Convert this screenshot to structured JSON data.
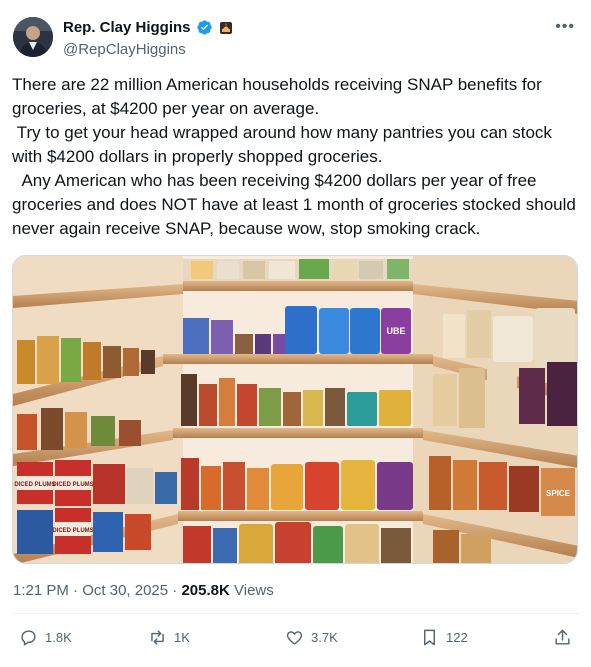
{
  "author": {
    "display_name": "Rep. Clay Higgins",
    "handle": "@RepClayHiggins",
    "verified_icon": "verified-badge-icon",
    "affiliation_icon": "us-capitol-icon",
    "avatar_icon": "profile-photo"
  },
  "tweet": {
    "text": "There are 22 million American households receiving SNAP benefits for groceries, at $4200 per year on average.\n Try to get your head wrapped around how many pantries you can stock with $4200 dollars in properly shopped groceries.\n  Any American who has been receiving $4200 dollars per year of free groceries and does NOT have at least 1 month of groceries stocked should never again receive SNAP, because wow, stop smoking crack.",
    "media": {
      "image_icon": "stocked-pantry-photo",
      "visible_labels": [
        "DICED PLUMS",
        "DICED PLUMS",
        "DICED PLUMS",
        "UBE",
        "SPICE"
      ]
    }
  },
  "meta": {
    "time": "1:21 PM",
    "separator": "·",
    "date": "Oct 30, 2025",
    "views_count": "205.8K",
    "views_label": "Views"
  },
  "actions": {
    "replies": "1.8K",
    "reposts": "1K",
    "likes": "3.7K",
    "bookmarks": "122"
  },
  "colors": {
    "text": "#0f1419",
    "secondary": "#536471",
    "verified": "#1d9bf0",
    "border": "#cfd9de"
  }
}
